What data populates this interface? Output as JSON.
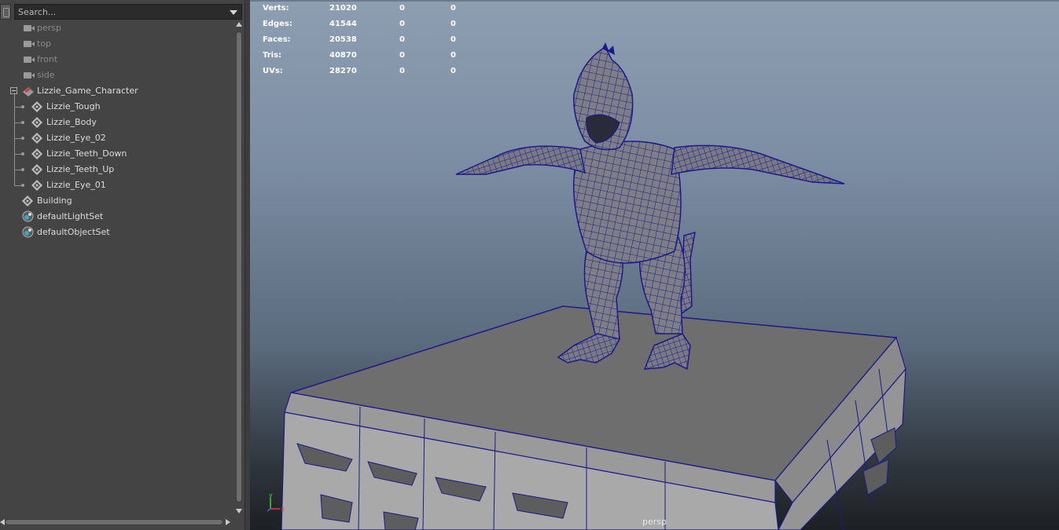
{
  "outliner": {
    "search_placeholder": "Search...",
    "items": [
      {
        "label": "persp"
      },
      {
        "label": "top"
      },
      {
        "label": "front"
      },
      {
        "label": "side"
      },
      {
        "label": "Lizzie_Game_Character"
      },
      {
        "label": "Lizzie_Tough"
      },
      {
        "label": "Lizzie_Body"
      },
      {
        "label": "Lizzie_Eye_02"
      },
      {
        "label": "Lizzie_Teeth_Down"
      },
      {
        "label": "Lizzie_Teeth_Up"
      },
      {
        "label": "Lizzie_Eye_01"
      },
      {
        "label": "Building"
      },
      {
        "label": "defaultLightSet"
      },
      {
        "label": "defaultObjectSet"
      }
    ]
  },
  "hud": {
    "rows": [
      {
        "label": "Verts:",
        "v1": "21020",
        "v2": "0",
        "v3": "0"
      },
      {
        "label": "Edges:",
        "v1": "41544",
        "v2": "0",
        "v3": "0"
      },
      {
        "label": "Faces:",
        "v1": "20538",
        "v2": "0",
        "v3": "0"
      },
      {
        "label": "Tris:",
        "v1": "40870",
        "v2": "0",
        "v3": "0"
      },
      {
        "label": "UVs:",
        "v1": "28270",
        "v2": "0",
        "v3": "0"
      }
    ]
  },
  "viewport": {
    "camera_label": "persp",
    "axis_labels": {
      "y": "y",
      "x": "x"
    },
    "wire_color": "#1a1a8c",
    "mesh_color": "#7d7d7d"
  },
  "icons": {
    "camera": "camera-icon",
    "mesh": "mesh-icon",
    "group": "group-icon",
    "set": "set-icon"
  }
}
